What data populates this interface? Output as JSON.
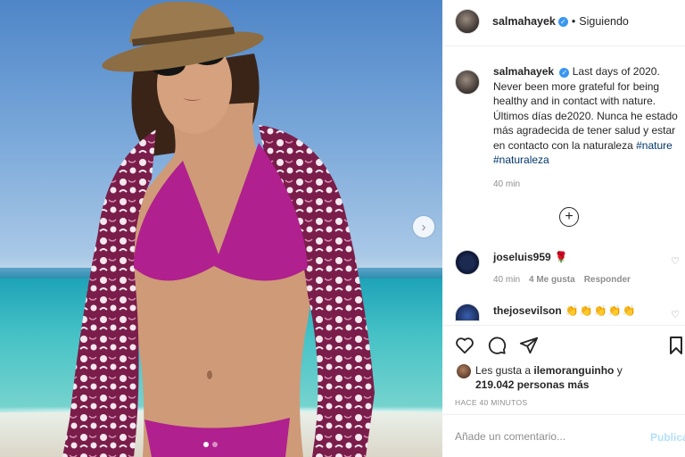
{
  "post": {
    "username": "salmahayek",
    "follow_state": "Siguiendo",
    "bullet": "•",
    "carousel": {
      "slides": 2,
      "active": 0
    }
  },
  "caption": {
    "username": "salmahayek",
    "text": "Last days of 2020. Never been more grateful for being healthy and in contact with nature. Últimos días de2020. Nunca he estado más agradecida de tener salud y estar en contacto con la naturaleza",
    "hashtags": [
      "#nature",
      "#naturaleza"
    ],
    "time": "40 min"
  },
  "comments": [
    {
      "username": "joseluis959",
      "emoji": "🌹",
      "time": "40 min",
      "likes": "4 Me gusta",
      "reply": "Responder"
    },
    {
      "username": "thejosevilson",
      "emoji": "👏👏👏👏👏"
    }
  ],
  "likes": {
    "prefix": "Les gusta a",
    "user": "ilemoranguinho",
    "conj": "y",
    "count": "219.042 personas más"
  },
  "timestamp": "HACE 40 MINUTOS",
  "comment_box": {
    "placeholder": "Añade un comentario...",
    "publish_label": "Publicar"
  },
  "icons": {
    "verified": "verified-badge-icon",
    "next": "chevron-right-icon",
    "load_more": "plus-circle-icon",
    "heart": "heart-icon",
    "comment": "comment-icon",
    "share": "paper-plane-icon",
    "bookmark": "bookmark-icon"
  },
  "colors": {
    "verified_blue": "#3897f0",
    "hashtag": "#00376b",
    "publish_disabled": "#b2dffc",
    "bikini": "#b0208e"
  }
}
